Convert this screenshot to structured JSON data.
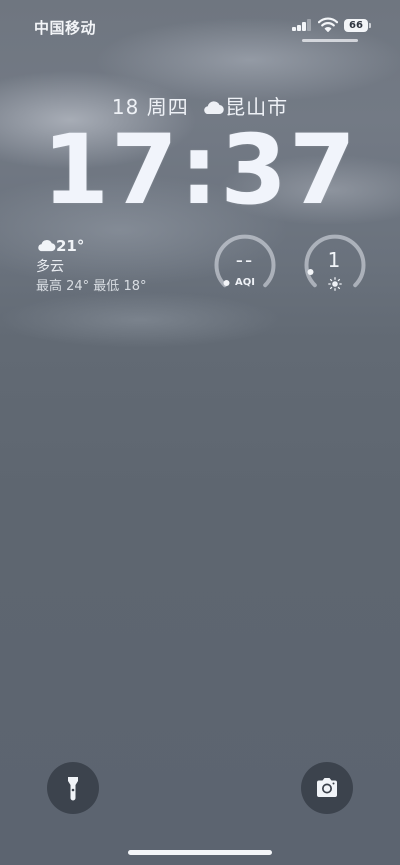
{
  "status_bar": {
    "carrier": "中国移动",
    "battery_percent": "66",
    "signal_bars": 3,
    "icons": [
      "cellular-signal-icon",
      "wifi-icon",
      "battery-icon"
    ]
  },
  "lock_screen": {
    "date": "18 周四",
    "city": "昆山市",
    "date_weather_icon": "cloud-icon",
    "time": "17:37"
  },
  "weather_widget": {
    "icon": "cloud-icon",
    "temperature": "21°",
    "condition": "多云",
    "range": "最高 24° 最低 18°"
  },
  "aqi_widget": {
    "value": "--",
    "label": "AQI"
  },
  "uv_widget": {
    "value": "1",
    "icon": "sun-icon"
  },
  "buttons": {
    "flashlight_icon": "flashlight-icon",
    "camera_icon": "camera-icon"
  },
  "colors": {
    "text": "#eef1f6",
    "button_bg": "#2c323c",
    "wallpaper_top": "#6f7680",
    "wallpaper_bottom": "#5c6470"
  }
}
